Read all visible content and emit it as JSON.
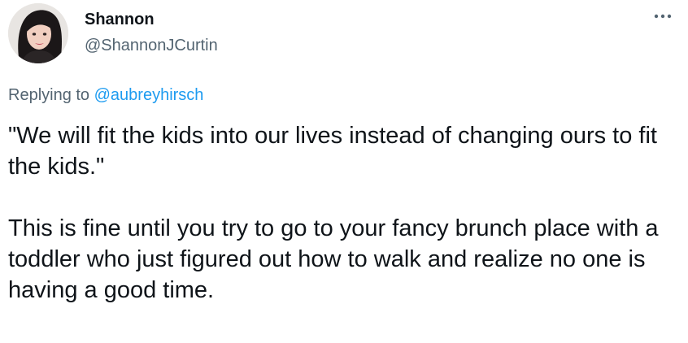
{
  "tweet": {
    "author": {
      "display_name": "Shannon",
      "handle": "@ShannonJCurtin",
      "avatar": "profile-photo"
    },
    "more_icon": "more-horizontal-icon",
    "reply": {
      "prefix": "Replying to",
      "mention": "@aubreyhirsch"
    },
    "paragraphs": [
      "\"We will fit the kids into our lives instead of changing ours to fit the kids.\"",
      "This is fine until you try to go to your fancy brunch place with a toddler who just figured out how to walk and realize no one is having a good time."
    ]
  },
  "colors": {
    "text": "#0f1419",
    "secondary": "#536471",
    "accent": "#1d9bf0",
    "background": "#ffffff"
  }
}
